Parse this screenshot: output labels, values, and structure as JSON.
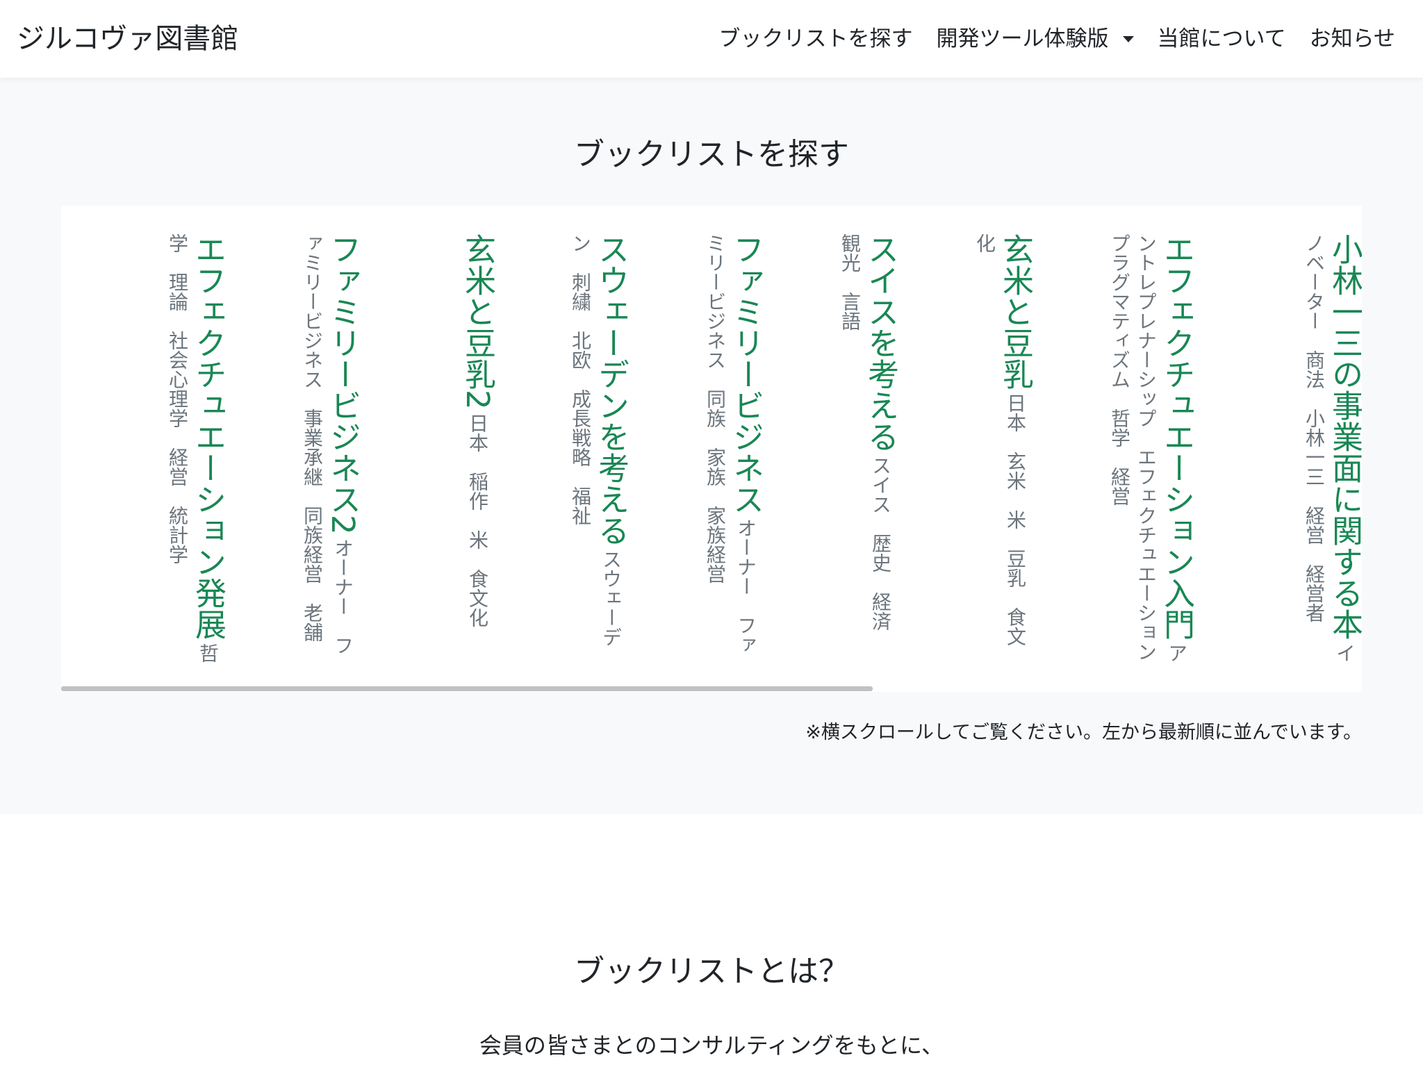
{
  "navbar": {
    "brand": "ジルコヴァ図書館",
    "items": [
      {
        "label": "ブックリストを探す"
      },
      {
        "label": "開発ツール体験版"
      },
      {
        "label": "当館について"
      },
      {
        "label": "お知らせ"
      }
    ]
  },
  "booklist": {
    "title": "ブックリストを探す",
    "scroll_note": "※横スクロールしてご覧ください。左から最新順に並んでいます。",
    "books": [
      {
        "title": "小林一三の事業面に関する本",
        "tags": "イノベーター　商法　小林一三　経営　経営者"
      },
      {
        "title": "エフェクチュエーション入門",
        "tags": "アントレプレナーシップ　エフェクチュエーション　プラグマティズム　哲学　経営"
      },
      {
        "title": "玄米と豆乳",
        "tags": "日本　玄米　米　豆乳　食文化"
      },
      {
        "title": "スイスを考える",
        "tags": "スイス　歴史　経済　観光　言語"
      },
      {
        "title": "ファミリービジネス",
        "tags": "オーナー　ファミリービジネス　同族　家族　家族経営"
      },
      {
        "title": "スウェーデンを考える",
        "tags": "スウェーデン　刺繍　北欧　成長戦略　福祉"
      },
      {
        "title": "玄米と豆乳2",
        "tags": "日本　稲作　米　食文化"
      },
      {
        "title": "ファミリービジネス2",
        "tags": "オーナー　ファミリービジネス　事業承継　同族経営　老舗"
      },
      {
        "title": "エフェクチュエーション発展",
        "tags": "哲学　理論　社会心理学　経営　統計学"
      }
    ]
  },
  "about": {
    "title": "ブックリストとは？",
    "text": "会員の皆さまとのコンサルティングをもとに、"
  }
}
